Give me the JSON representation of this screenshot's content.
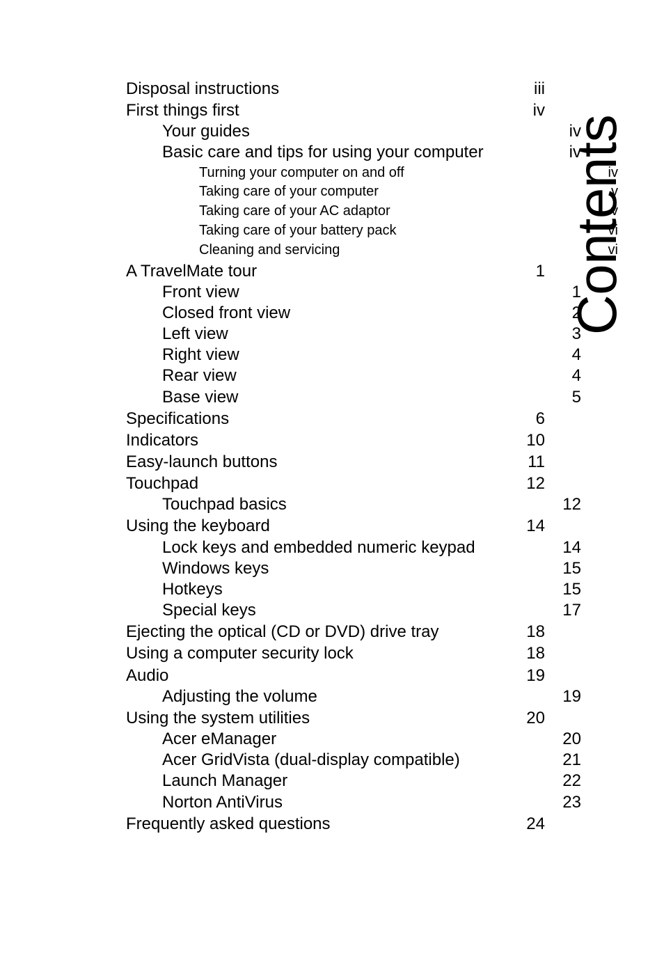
{
  "page": {
    "title": "Contents",
    "background_color": "#ffffff",
    "text_color": "#000000"
  },
  "toc": {
    "entries": [
      {
        "label": "Disposal instructions",
        "page": "iii",
        "level": 1
      },
      {
        "label": "First things first",
        "page": "iv",
        "level": 1
      },
      {
        "label": "Your guides",
        "page": "iv",
        "level": 2
      },
      {
        "label": "Basic care and tips for using your computer",
        "page": "iv",
        "level": 2
      },
      {
        "label": "Turning your computer on and off",
        "page": "iv",
        "level": 3
      },
      {
        "label": "Taking care of your computer",
        "page": "v",
        "level": 3
      },
      {
        "label": "Taking care of your AC adaptor",
        "page": "v",
        "level": 3
      },
      {
        "label": "Taking care of your battery pack",
        "page": "vi",
        "level": 3
      },
      {
        "label": "Cleaning and servicing",
        "page": "vi",
        "level": 3
      },
      {
        "label": "A TravelMate tour",
        "page": "1",
        "level": 1
      },
      {
        "label": "Front view",
        "page": "1",
        "level": 2
      },
      {
        "label": "Closed front view",
        "page": "2",
        "level": 2
      },
      {
        "label": "Left view",
        "page": "3",
        "level": 2
      },
      {
        "label": "Right view",
        "page": "4",
        "level": 2
      },
      {
        "label": "Rear view",
        "page": "4",
        "level": 2
      },
      {
        "label": "Base view",
        "page": "5",
        "level": 2
      },
      {
        "label": "Specifications",
        "page": "6",
        "level": 1
      },
      {
        "label": "Indicators",
        "page": "10",
        "level": 1
      },
      {
        "label": "Easy-launch buttons",
        "page": "11",
        "level": 1
      },
      {
        "label": "Touchpad",
        "page": "12",
        "level": 1
      },
      {
        "label": "Touchpad basics",
        "page": "12",
        "level": 2
      },
      {
        "label": "Using the keyboard",
        "page": "14",
        "level": 1
      },
      {
        "label": "Lock keys and embedded numeric keypad",
        "page": "14",
        "level": 2
      },
      {
        "label": "Windows keys",
        "page": "15",
        "level": 2
      },
      {
        "label": "Hotkeys",
        "page": "15",
        "level": 2
      },
      {
        "label": "Special keys",
        "page": "17",
        "level": 2
      },
      {
        "label": "Ejecting the optical (CD or DVD) drive tray",
        "page": "18",
        "level": 1
      },
      {
        "label": "Using a computer security lock",
        "page": "18",
        "level": 1
      },
      {
        "label": "Audio",
        "page": "19",
        "level": 1
      },
      {
        "label": "Adjusting the volume",
        "page": "19",
        "level": 2
      },
      {
        "label": "Using the system utilities",
        "page": "20",
        "level": 1
      },
      {
        "label": "Acer eManager",
        "page": "20",
        "level": 2
      },
      {
        "label": "Acer GridVista (dual-display compatible)",
        "page": "21",
        "level": 2
      },
      {
        "label": "Launch Manager",
        "page": "22",
        "level": 2
      },
      {
        "label": "Norton AntiVirus",
        "page": "23",
        "level": 2
      },
      {
        "label": "Frequently asked questions",
        "page": "24",
        "level": 1
      }
    ]
  }
}
